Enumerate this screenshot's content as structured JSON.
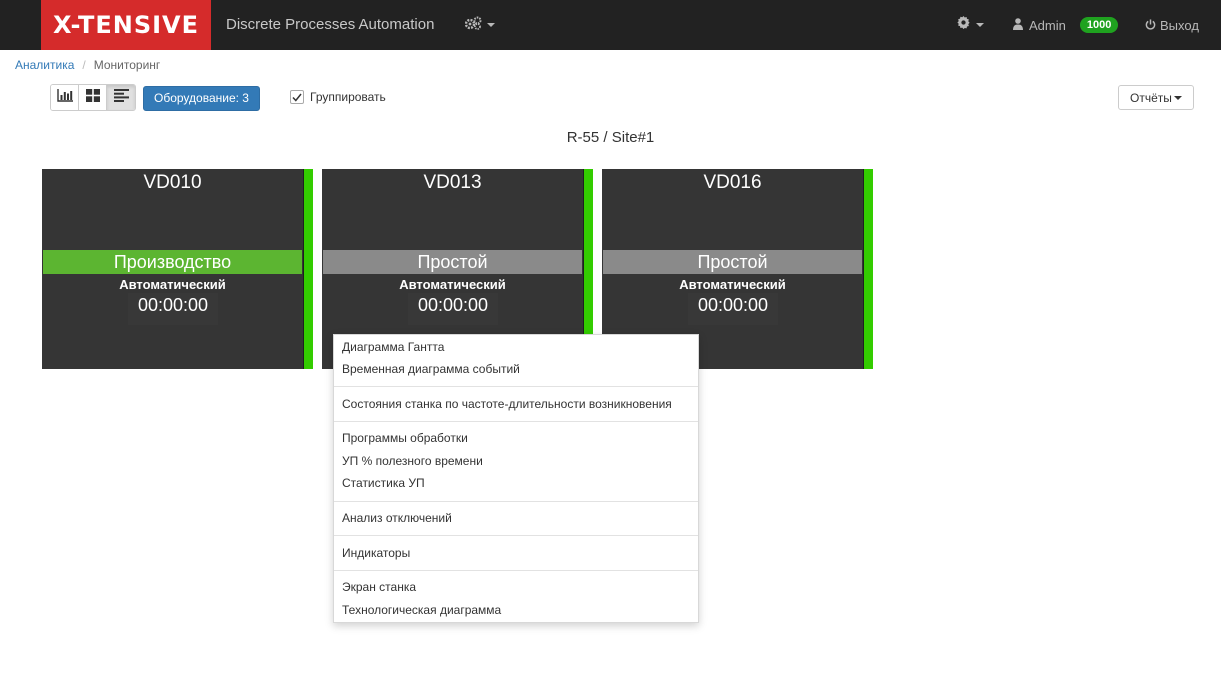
{
  "navbar": {
    "brand": "X-TENSIVE",
    "app_title": "Discrete Processes Automation",
    "user_name": "Admin",
    "user_badge": "1000",
    "logout_label": "Выход",
    "colors": {
      "background": "#222222",
      "brand": "#d52b2b",
      "badge": "#1fa21f"
    }
  },
  "breadcrumb": {
    "items": [
      "Аналитика",
      "Мониторинг"
    ]
  },
  "toolbar": {
    "view_buttons": [
      "bar-chart-icon",
      "grid-icon",
      "list-icon"
    ],
    "equipment_label": "Оборудование: 3",
    "group_label": "Группировать",
    "group_checked": true,
    "reports_label": "Отчёты"
  },
  "group": {
    "title": "R-55 / Site#1"
  },
  "machines": [
    {
      "name": "VD010",
      "state": "Производство",
      "mode": "Автоматический",
      "timer": "00:00:00",
      "state_color": "#5cb531"
    },
    {
      "name": "VD013",
      "state": "Простой",
      "mode": "Автоматический",
      "timer": "00:00:00",
      "state_color": "#8a8a8a"
    },
    {
      "name": "VD016",
      "state": "Простой",
      "mode": "Автоматический",
      "timer": "00:00:00",
      "state_color": "#8a8a8a"
    }
  ],
  "context_menu": {
    "groups": [
      [
        "Диаграмма Гантта",
        "Временная диаграмма событий"
      ],
      [
        "Состояния станка по частоте-длительности возникновения"
      ],
      [
        "Программы обработки",
        "УП % полезного времени",
        "Статистика УП"
      ],
      [
        "Анализ отключений"
      ],
      [
        "Индикаторы"
      ],
      [
        "Экран станка",
        "Технологическая диаграмма"
      ]
    ]
  }
}
